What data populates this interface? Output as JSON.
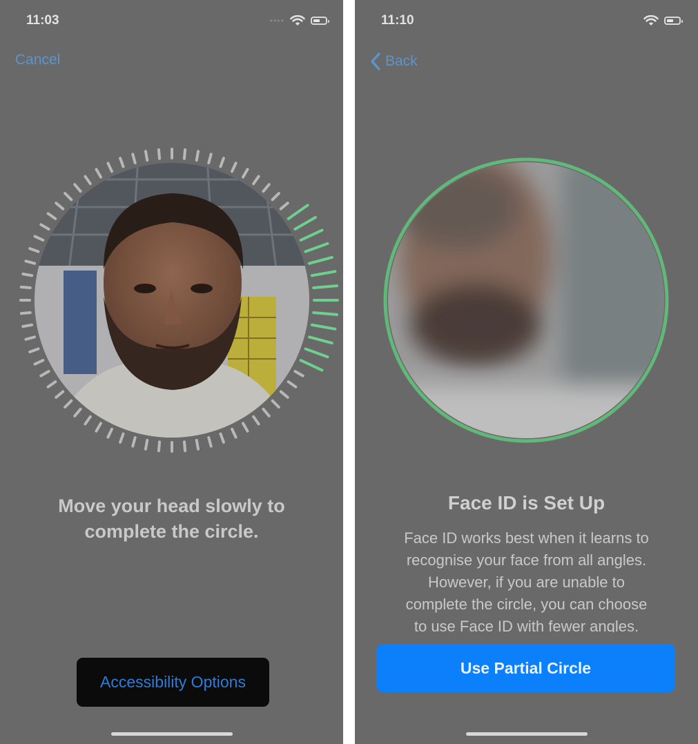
{
  "left_screen": {
    "status": {
      "time": "11:03"
    },
    "nav": {
      "cancel_label": "Cancel"
    },
    "scan": {
      "progress_arc_degrees_completed": [
        -28,
        38
      ]
    },
    "instruction_lines": [
      "Move your head slowly to",
      "complete the circle."
    ],
    "accessibility_button_label": "Accessibility Options"
  },
  "right_screen": {
    "status": {
      "time": "11:10"
    },
    "nav": {
      "back_label": "Back"
    },
    "title": "Face ID is Set Up",
    "body_lines": [
      "Face ID works best when it learns to",
      "recognise your face from all angles.",
      "However, if you are unable to",
      "complete the circle, you can choose",
      "to use Face ID with fewer angles."
    ],
    "primary_button_label": "Use Partial Circle"
  },
  "colors": {
    "overlay_gray": "#696969",
    "tick_gray": "#b8b8b8",
    "tick_green": "#6fcf8f",
    "link_blue": "#5f94c9",
    "button_blue": "#0b80fa",
    "ring_green": "#61b878"
  },
  "icons": [
    "wifi-icon",
    "battery-icon",
    "chevron-left-icon",
    "signal-dots-icon"
  ]
}
